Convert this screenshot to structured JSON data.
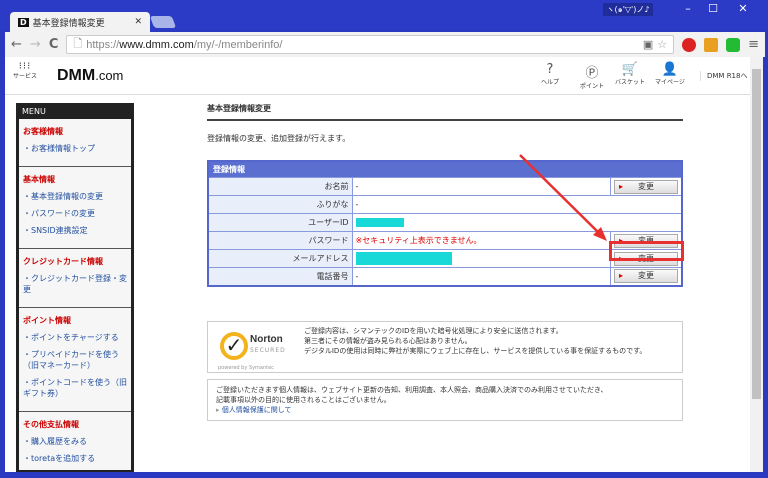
{
  "browser": {
    "tab_title": "基本登録情報変更",
    "url_scheme": "https://",
    "url_host": "www.dmm.com",
    "url_path": "/my/-/memberinfo/",
    "title_badge": "ヽ(๑'▽')ノ♪"
  },
  "header": {
    "services": "サービス",
    "logo": "DMM",
    "logo_suffix": ".com",
    "icons": [
      {
        "icon": "help-icon",
        "glyph": "?",
        "label": "ヘルプ"
      },
      {
        "icon": "point-icon",
        "glyph": "Ⓟ",
        "label": "ポイント"
      },
      {
        "icon": "cart-icon",
        "glyph": "🛒",
        "label": "バスケット"
      },
      {
        "icon": "user-icon",
        "glyph": "👤",
        "label": "マイページ"
      }
    ],
    "dmm_r18": "DMM R18へ"
  },
  "menu": {
    "title": "MENU",
    "sections": [
      {
        "heading": "お客様情報",
        "items": [
          "・お客様情報トップ"
        ]
      },
      {
        "heading": "基本情報",
        "items": [
          "・基本登録情報の変更",
          "・パスワードの変更",
          "・SNSID連携設定"
        ]
      },
      {
        "heading": "クレジットカード情報",
        "items": [
          "・クレジットカード登録・変更"
        ]
      },
      {
        "heading": "ポイント情報",
        "items": [
          "・ポイントをチャージする",
          "・プリペイドカードを使う（旧マネーカード）",
          "・ポイントコードを使う（旧ギフト券）"
        ]
      },
      {
        "heading": "その他支払情報",
        "items": [
          "・購入履歴をみる",
          "・toretaを追加する"
        ]
      }
    ]
  },
  "main": {
    "title": "基本登録情報変更",
    "intro": "登録情報の変更、追加登録が行えます。",
    "table": {
      "caption": "登録情報",
      "rows": [
        {
          "label": "お名前",
          "value": "-",
          "button": "変更"
        },
        {
          "label": "ふりがな",
          "value": "-"
        },
        {
          "label": "ユーザーID",
          "value": ""
        },
        {
          "label": "パスワード",
          "value": "※セキュリティ上表示できません。",
          "button": "変更"
        },
        {
          "label": "メールアドレス",
          "value": "",
          "button": "変更"
        },
        {
          "label": "電話番号",
          "value": "-",
          "button": "変更"
        }
      ]
    },
    "norton": {
      "brand": "Norton",
      "secured": "SECURED",
      "powered": "powered by Symantec",
      "lines": [
        "ご登録内容は、シマンテックのIDを用いた暗号化処理により安全に送信されます。",
        "第三者にその情報が盗み見られる心配はありません。",
        "デジタルIDの使用は同時に弊社が実際にウェブ上に存在し、サービスを提供している事を保証するものです。"
      ]
    },
    "privacy": {
      "lines": [
        "ご登録いただきます個人情報は、ウェブサイト更新の告知、利用調査、本人照会、商品購入決済でのみ利用させていただき、",
        "記載事項以外の目的に使用されることはございません。"
      ],
      "link": "個人情報保護に関して"
    }
  },
  "colors": {
    "annotation": "#e83030",
    "table_header": "#5a6fd0",
    "mask": "#18d8d8"
  }
}
